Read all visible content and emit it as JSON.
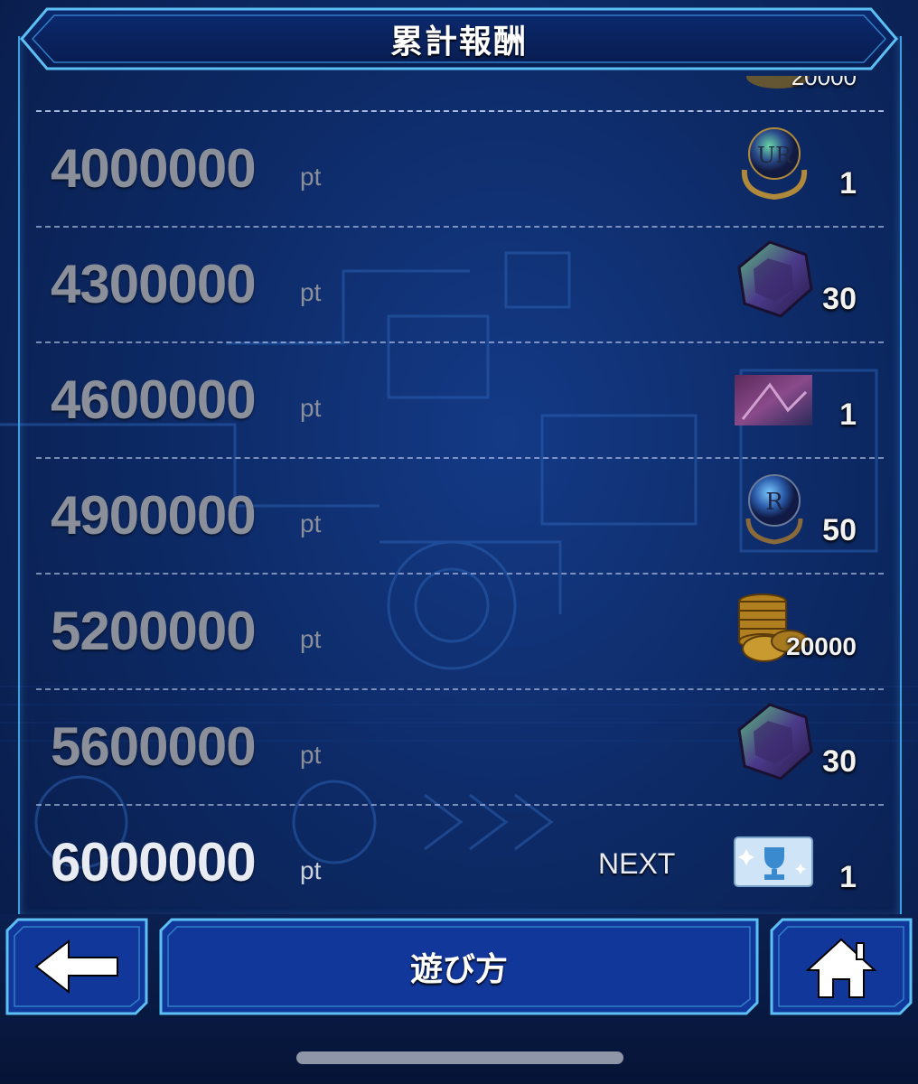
{
  "header": {
    "title": "累計報酬"
  },
  "rewards": {
    "unit": "pt",
    "next_label": "NEXT",
    "partial_qty": "20000",
    "rows": [
      {
        "points": "4000000",
        "icon": "ur-orb-icon",
        "qty": "1"
      },
      {
        "points": "4300000",
        "icon": "gem-icon",
        "qty": "30"
      },
      {
        "points": "4600000",
        "icon": "card-art-icon",
        "qty": "1"
      },
      {
        "points": "4900000",
        "icon": "r-orb-icon",
        "qty": "50"
      },
      {
        "points": "5200000",
        "icon": "gold-coins-icon",
        "qty": "20000"
      },
      {
        "points": "5600000",
        "icon": "gem-icon",
        "qty": "30"
      },
      {
        "points": "6000000",
        "icon": "trophy-ticket-icon",
        "qty": "1"
      }
    ]
  },
  "footer": {
    "back_icon": "left-arrow-icon",
    "howto_label": "遊び方",
    "home_icon": "home-icon"
  },
  "colors": {
    "frame": "#3aa0e0",
    "background": "#0d2a66",
    "button": "#12379a"
  }
}
